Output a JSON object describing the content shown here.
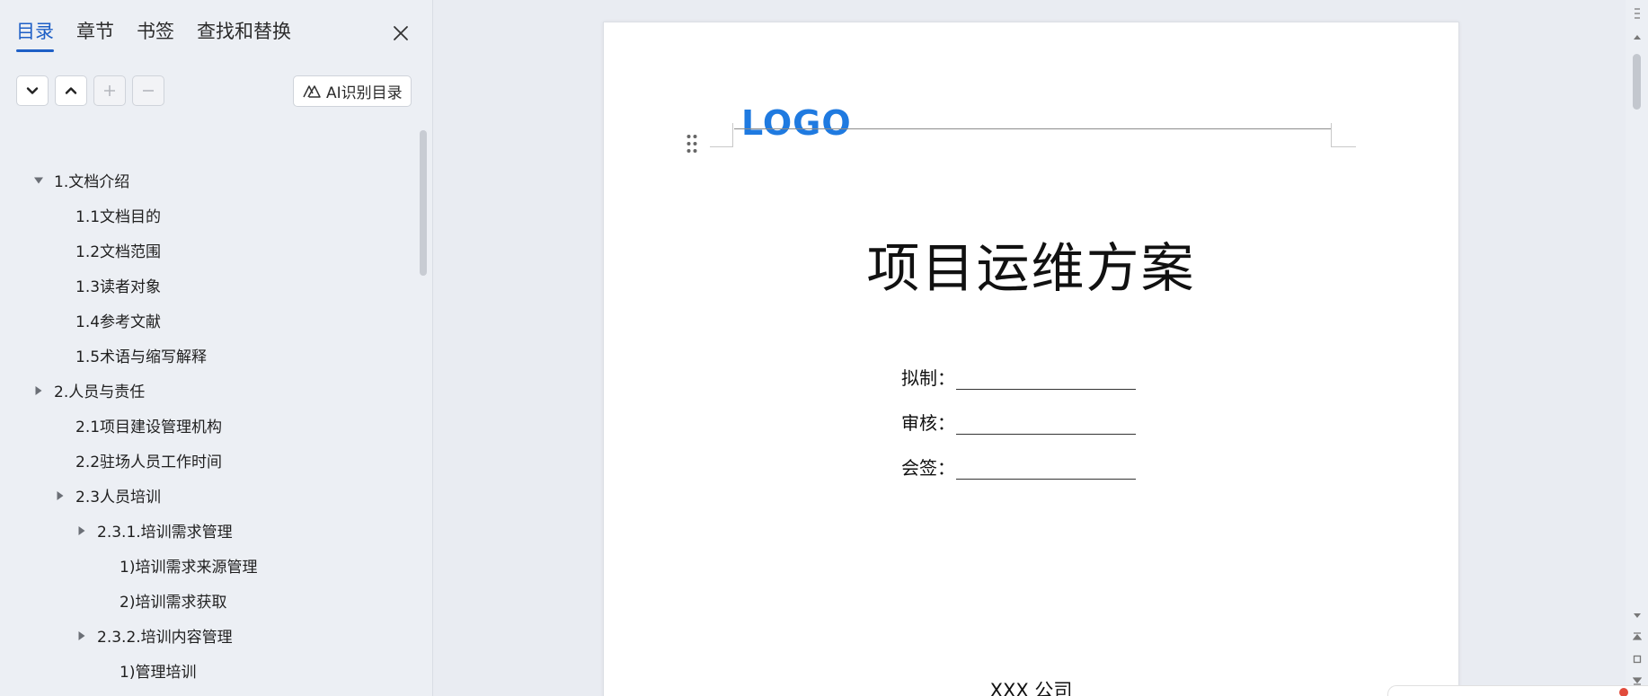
{
  "nav": {
    "tabs": [
      {
        "label": "目录",
        "active": true
      },
      {
        "label": "章节",
        "active": false
      },
      {
        "label": "书签",
        "active": false
      },
      {
        "label": "查找和替换",
        "active": false
      }
    ],
    "ai_button_label": "AI识别目录",
    "toc": [
      {
        "label": "1.文档介绍",
        "level": 0,
        "caret": "down"
      },
      {
        "label": "1.1文档目的",
        "level": 1,
        "caret": "none"
      },
      {
        "label": "1.2文档范围",
        "level": 1,
        "caret": "none"
      },
      {
        "label": "1.3读者对象",
        "level": 1,
        "caret": "none"
      },
      {
        "label": "1.4参考文献",
        "level": 1,
        "caret": "none"
      },
      {
        "label": "1.5术语与缩写解释",
        "level": 1,
        "caret": "none"
      },
      {
        "label": "2.人员与责任",
        "level": 0,
        "caret": "right"
      },
      {
        "label": "2.1项目建设管理机构",
        "level": 1,
        "caret": "none"
      },
      {
        "label": "2.2驻场人员工作时间",
        "level": 1,
        "caret": "none"
      },
      {
        "label": "2.3人员培训",
        "level": 1,
        "caret": "right"
      },
      {
        "label": "2.3.1.培训需求管理",
        "level": 2,
        "caret": "right"
      },
      {
        "label": "1)培训需求来源管理",
        "level": 3,
        "caret": "none"
      },
      {
        "label": "2)培训需求获取",
        "level": 3,
        "caret": "none"
      },
      {
        "label": "2.3.2.培训内容管理",
        "level": 2,
        "caret": "right"
      },
      {
        "label": "1)管理培训",
        "level": 3,
        "caret": "none"
      }
    ]
  },
  "document": {
    "logo_text": "LOGO",
    "logo_color": "#1f7ae0",
    "title": "项目运维方案",
    "sign_fields": [
      {
        "label": "拟制："
      },
      {
        "label": "审核："
      },
      {
        "label": "会签："
      }
    ],
    "company": "XXX 公司"
  },
  "colors": {
    "accent": "#1e5fc6",
    "panel_bg": "#eceff4",
    "canvas_bg": "#e9ecf2",
    "notification_dot": "#e14b3c"
  }
}
